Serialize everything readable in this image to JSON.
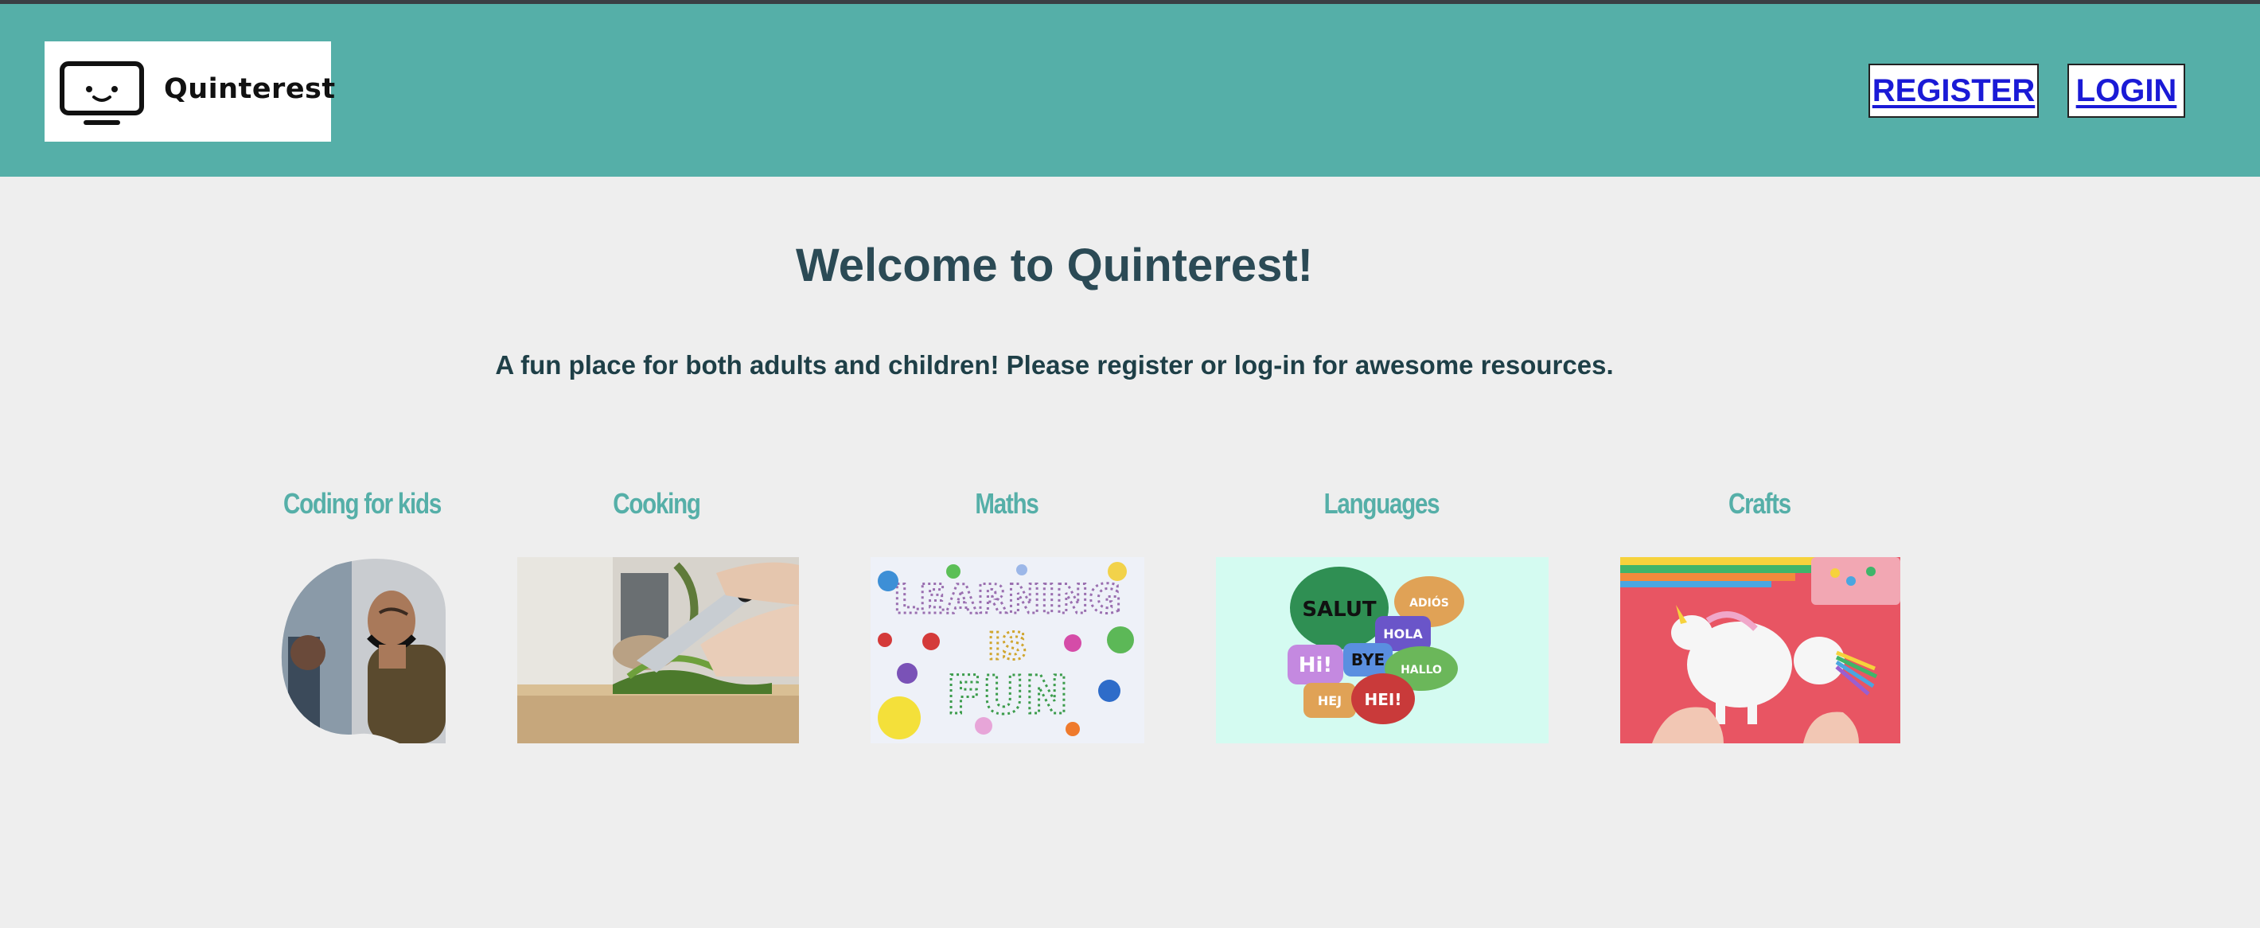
{
  "header": {
    "logo_text": "Quinterest",
    "logo_icon": "tv-smiley-icon",
    "register_label": "REGISTER",
    "login_label": "LOGIN"
  },
  "main": {
    "title": "Welcome to Quinterest!",
    "subtitle": "A fun place for both adults and children! Please register or log-in for awesome resources."
  },
  "categories": [
    {
      "label": "Coding for kids",
      "image": "person-headphones-photo"
    },
    {
      "label": "Cooking",
      "image": "chopping-herbs-photo"
    },
    {
      "label": "Maths",
      "image": "learning-is-fun-image"
    },
    {
      "label": "Languages",
      "image": "speech-bubbles-image",
      "bubbles": [
        "SALUT",
        "ADIÓS",
        "HOLA",
        "Hi!",
        "BYE",
        "HALLO",
        "HEJ",
        "HEI!"
      ]
    },
    {
      "label": "Crafts",
      "image": "paper-unicorn-photo"
    }
  ],
  "maths_image_text": {
    "line1": "LEARNING",
    "line2": "IS",
    "line3": "FUN"
  },
  "colors": {
    "header": "#55afa8",
    "accent": "#55afa8",
    "link": "#1a1ad6",
    "title": "#2b4a55",
    "background": "#eeeeee"
  }
}
